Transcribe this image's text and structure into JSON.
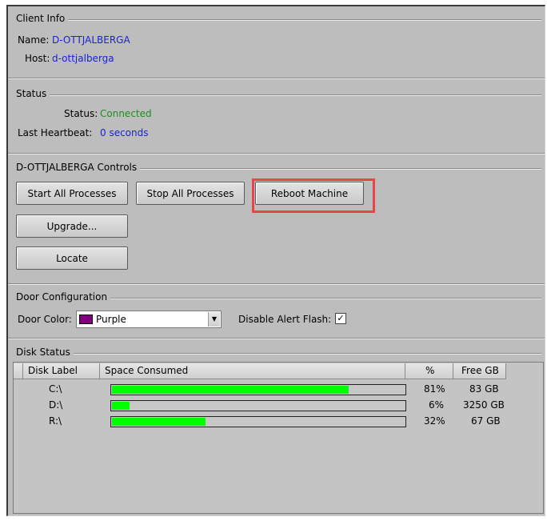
{
  "client_info": {
    "section_title": "Client Info",
    "name_label": "Name:",
    "name_value": "D-OTTJALBERGA",
    "host_label": "Host:",
    "host_value": "d-ottjalberga"
  },
  "status": {
    "section_title": "Status",
    "status_label": "Status:",
    "status_value": "Connected",
    "heartbeat_label": "Last Heartbeat:",
    "heartbeat_value": "0 seconds"
  },
  "controls": {
    "section_title": "D-OTTJALBERGA Controls",
    "start_all_label": "Start All Processes",
    "stop_all_label": "Stop All Processes",
    "reboot_label": "Reboot Machine",
    "upgrade_label": "Upgrade...",
    "locate_label": "Locate"
  },
  "door_config": {
    "section_title": "Door Configuration",
    "door_color_label": "Door Color:",
    "door_color_value": "Purple",
    "door_color_swatch": "#800080",
    "alert_flash_label": "Disable Alert Flash:",
    "alert_flash_checked": true,
    "check_glyph": "✓",
    "dropdown_glyph": "▼"
  },
  "disk_status": {
    "section_title": "Disk Status",
    "columns": [
      "Disk Label",
      "Space Consumed",
      "%",
      "Free GB"
    ],
    "rows": [
      {
        "label": "C:\\",
        "used_fraction": 0.81,
        "percent": "81%",
        "free": "83 GB"
      },
      {
        "label": "D:\\",
        "used_fraction": 0.06,
        "percent": "6%",
        "free": "3250 GB"
      },
      {
        "label": "R:\\",
        "used_fraction": 0.32,
        "percent": "32%",
        "free": "67 GB"
      }
    ],
    "bar_color": "#00ff00"
  }
}
